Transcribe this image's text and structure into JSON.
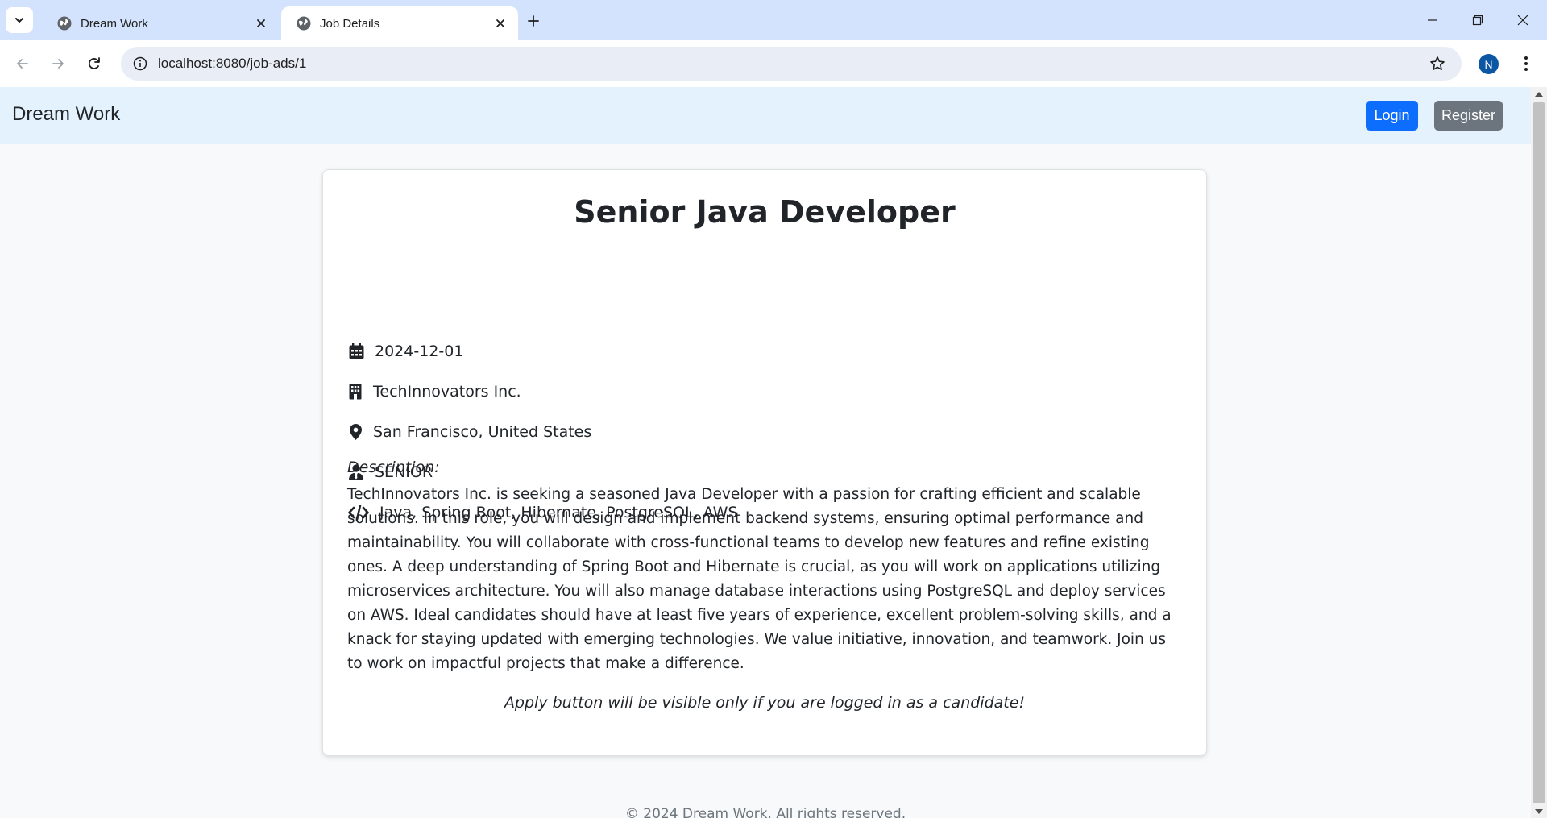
{
  "browser": {
    "tabs": [
      {
        "title": "Dream Work",
        "active": false
      },
      {
        "title": "Job Details",
        "active": true
      }
    ],
    "url": "localhost:8080/job-ads/1",
    "profile_initial": "N"
  },
  "navbar": {
    "brand": "Dream Work",
    "login_label": "Login",
    "register_label": "Register"
  },
  "job": {
    "title": "Senior Java Developer",
    "date": "2024-12-01",
    "company": "TechInnovators Inc.",
    "location": "San Francisco, United States",
    "level": "SENIOR",
    "skills": "Java, Spring Boot, Hibernate, PostgreSQL, AWS",
    "description_label": "Description:",
    "description": "TechInnovators Inc. is seeking a seasoned Java Developer with a passion for crafting efficient and scalable solutions. In this role, you will design and implement backend systems, ensuring optimal performance and maintainability. You will collaborate with cross-functional teams to develop new features and refine existing ones. A deep understanding of Spring Boot and Hibernate is crucial, as you will work on applications utilizing microservices architecture. You will also manage database interactions using PostgreSQL and deploy services on AWS. Ideal candidates should have at least five years of experience, excellent problem-solving skills, and a knack for staying updated with emerging technologies. We value initiative, innovation, and teamwork. Join us to work on impactful projects that make a difference.",
    "apply_note": "Apply button will be visible only if you are logged in as a candidate!"
  },
  "footer": {
    "text": "© 2024 Dream Work. All rights reserved."
  },
  "colors": {
    "primary": "#0d6efd",
    "secondary": "#6c757d",
    "navbar_bg": "#e3f2fd",
    "tabstrip_bg": "#d3e3fd"
  }
}
